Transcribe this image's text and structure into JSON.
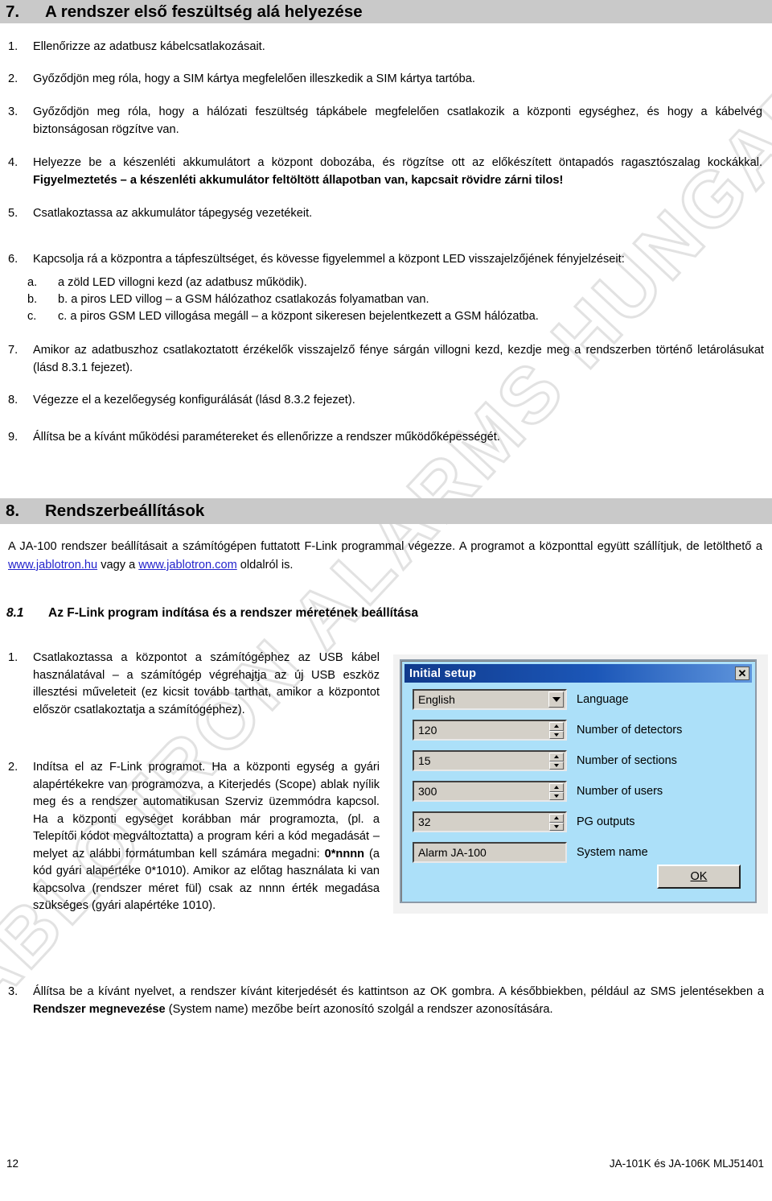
{
  "section7": {
    "number": "7.",
    "title": "A rendszer első feszültség alá helyezése",
    "items": [
      {
        "marker": "1.",
        "text": "Ellenőrizze az adatbusz kábelcsatlakozásait."
      },
      {
        "marker": "2.",
        "text": "Győződjön meg róla, hogy a SIM kártya megfelelően illeszkedik a SIM kártya tartóba."
      },
      {
        "marker": "3.",
        "text": "Győződjön meg róla, hogy a hálózati feszültség tápkábele megfelelően csatlakozik a központi egységhez, és hogy a kábelvég biztonságosan rögzítve van."
      },
      {
        "marker": "4.",
        "text_before_bold": "Helyezze be a készenléti akkumulátort a központ dobozába, és rögzítse ott az előkészített öntapadós ragasztószalag kockákkal. ",
        "bold": "Figyelmeztetés – a készenléti akkumulátor feltöltött állapotban van, kapcsait rövidre zárni tilos!"
      },
      {
        "marker": "5.",
        "text": "Csatlakoztassa az akkumulátor tápegység vezetékeit."
      },
      {
        "marker": "6.",
        "text": "Kapcsolja rá a központra a tápfeszültséget, és kövesse figyelemmel a központ LED visszajelzőjének fényjelzéseit:"
      },
      {
        "marker": "7.",
        "text": "Amikor az adatbuszhoz csatlakoztatott érzékelők visszajelző fénye sárgán villogni kezd, kezdje meg a rendszerben történő letárolásukat (lásd 8.3.1 fejezet)."
      },
      {
        "marker": "8.",
        "text": "Végezze el a kezelőegység konfigurálását (lásd 8.3.2 fejezet)."
      },
      {
        "marker": "9.",
        "text": "Állítsa be a kívánt működési paramétereket és ellenőrizze a rendszer működőképességét."
      }
    ],
    "sub_items": [
      {
        "marker": "a.",
        "text": "a zöld LED villogni kezd (az adatbusz működik)."
      },
      {
        "marker": "b.",
        "text": "b. a piros LED villog – a GSM hálózathoz csatlakozás folyamatban van."
      },
      {
        "marker": "c.",
        "text": "c. a piros GSM LED villogása megáll – a központ sikeresen bejelentkezett a GSM hálózatba."
      }
    ]
  },
  "section8": {
    "number": "8.",
    "title": "Rendszerbeállítások",
    "intro_part1": "A JA-100 rendszer beállításait a számítógépen futtatott F-Link programmal végezze. A programot a központtal együtt szállítjuk, de letölthető a ",
    "link1": "www.jablotron.hu",
    "intro_part2": " vagy a ",
    "link2": "www.jablotron.com",
    "intro_part3": " oldalról is.",
    "sub": {
      "number": "8.1",
      "title": "Az F-Link program indítása és a rendszer méretének beállítása",
      "items": [
        {
          "marker": "1.",
          "text": "Csatlakoztassa a központot a számítógéphez az USB kábel használatával – a számítógép végrehajtja az új USB eszköz illesztési műveleteit (ez kicsit tovább tarthat, amikor a központot először csatlakoztatja a számítógéphez)."
        },
        {
          "marker": "2.",
          "part1": "Indítsa el az F-Link programot. Ha a központi egység a gyári alapértékekre van programozva, a Kiterjedés (Scope) ablak nyílik meg és a rendszer automatikusan Szerviz üzemmódra kapcsol. Ha a központi egységet korábban már programozta, (pl. a Telepítői kódot megváltoztatta) a program kéri a kód megadását – melyet az alábbi formátumban kell számára megadni: ",
          "bold": "0*nnnn",
          "part2": " (a kód gyári alapértéke 0*1010). Amikor az előtag használata ki van kapcsolva (rendszer méret fül) csak az nnnn érték megadása szükséges (gyári alapértéke 1010)."
        },
        {
          "marker": "3.",
          "part1": "Állítsa be a kívánt nyelvet, a rendszer kívánt kiterjedését és kattintson az OK gombra. A későbbiekben, például az SMS jelentésekben a ",
          "bold": "Rendszer megnevezése",
          "part2": " (System name) mezőbe beírt azonosító szolgál a rendszer azonosítására."
        }
      ]
    }
  },
  "dialog": {
    "title": "Initial setup",
    "close_label": "✕",
    "rows": [
      {
        "value": "English",
        "label": "Language",
        "control": "combo"
      },
      {
        "value": "120",
        "label": "Number of detectors",
        "control": "spin"
      },
      {
        "value": "15",
        "label": "Number of sections",
        "control": "spin"
      },
      {
        "value": "300",
        "label": "Number of users",
        "control": "spin"
      },
      {
        "value": "32",
        "label": "PG outputs",
        "control": "spin"
      },
      {
        "value": "Alarm JA-100",
        "label": "System name",
        "control": "text"
      }
    ],
    "ok_label": "OK"
  },
  "watermark": {
    "text": "JABLOTRON ALARMS HUNGARIA"
  },
  "footer": {
    "page_number": "12",
    "doc_id": "JA-101K és JA-106K MLJ51401"
  }
}
